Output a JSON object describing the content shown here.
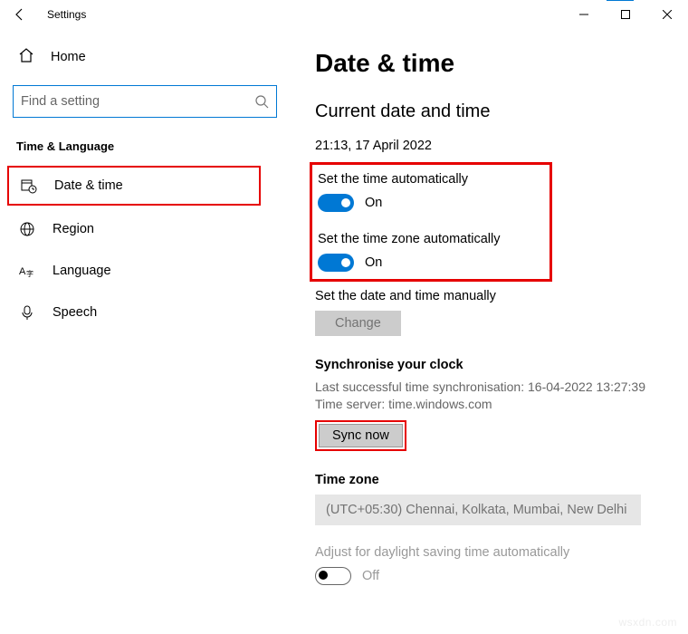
{
  "window": {
    "title": "Settings"
  },
  "sidebar": {
    "home": "Home",
    "search_placeholder": "Find a setting",
    "category": "Time & Language",
    "items": [
      {
        "label": "Date & time"
      },
      {
        "label": "Region"
      },
      {
        "label": "Language"
      },
      {
        "label": "Speech"
      }
    ]
  },
  "content": {
    "title": "Date & time",
    "subtitle": "Current date and time",
    "datetime": "21:13, 17 April 2022",
    "auto_time_label": "Set the time automatically",
    "auto_time_state": "On",
    "auto_zone_label": "Set the time zone automatically",
    "auto_zone_state": "On",
    "manual_label": "Set the date and time manually",
    "change_btn": "Change",
    "sync_title": "Synchronise your clock",
    "sync_last": "Last successful time synchronisation: 16-04-2022 13:27:39",
    "sync_server": "Time server: time.windows.com",
    "sync_btn": "Sync now",
    "tz_title": "Time zone",
    "tz_value": "(UTC+05:30) Chennai, Kolkata, Mumbai, New Delhi",
    "dst_label": "Adjust for daylight saving time automatically",
    "dst_state": "Off"
  },
  "watermark": "wsxdn.com"
}
